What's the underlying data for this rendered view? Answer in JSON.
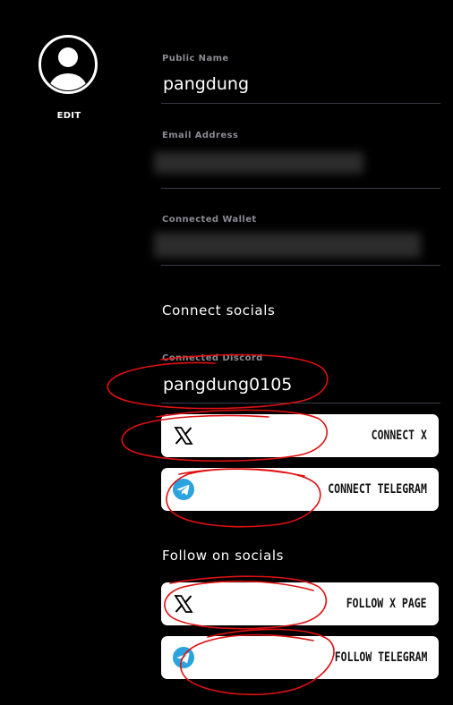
{
  "profile": {
    "edit_label": "EDIT"
  },
  "fields": {
    "public_name_label": "Public Name",
    "public_name_value": "pangdung",
    "email_label": "Email Address",
    "wallet_label": "Connected Wallet"
  },
  "connect_socials": {
    "title": "Connect socials",
    "discord_label": "Connected Discord",
    "discord_value": "pangdung0105",
    "connect_x_label": "CONNECT X",
    "connect_telegram_label": "CONNECT TELEGRAM"
  },
  "follow_socials": {
    "title": "Follow on socials",
    "follow_x_label": "FOLLOW X PAGE",
    "follow_telegram_label": "FOLLOW TELEGRAM"
  },
  "icons": {
    "avatar": "user-avatar-icon",
    "x": "x-logo-icon",
    "telegram": "telegram-icon"
  },
  "colors": {
    "background": "#000000",
    "label_gray": "#8a8a93",
    "divider": "#3a3a4a",
    "button_bg": "#ffffff",
    "telegram_blue": "#2aa3df",
    "annotation_red": "#e01010"
  }
}
